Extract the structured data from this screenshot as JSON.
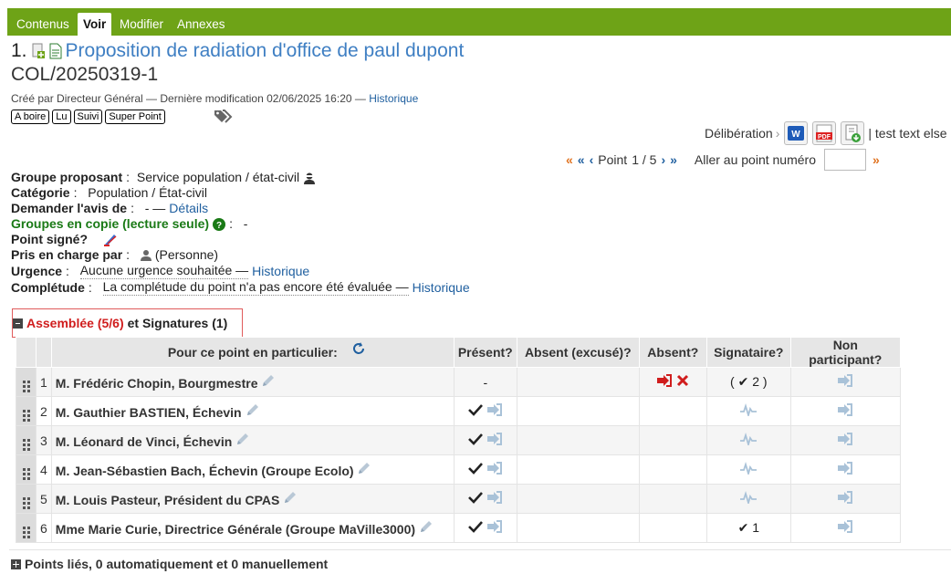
{
  "tabs": [
    {
      "label": "Contenus"
    },
    {
      "label": "Voir"
    },
    {
      "label": "Modifier"
    },
    {
      "label": "Annexes"
    }
  ],
  "item": {
    "number": "1.",
    "title": "Proposition de radiation d'office de paul dupont",
    "reference": "COL/20250319-1",
    "meta_prefix": "Créé par Directeur Général — Dernière modification 02/06/2025 16:20 —",
    "meta_link": "Historique",
    "labels": [
      "A boire",
      "Lu",
      "Suivi",
      "Super Point"
    ]
  },
  "actions": {
    "deliberation_label": "Délibération",
    "extra_text": "| test text else"
  },
  "navigation": {
    "point_label": "Point",
    "point_value": "1 / 5",
    "goto_label": "Aller au point numéro",
    "goto_value": ""
  },
  "fields": {
    "groupe_proposant": {
      "label": "Groupe proposant",
      "value": "Service population / état-civil"
    },
    "categorie": {
      "label": "Catégorie",
      "value": "Population / État-civil"
    },
    "avis": {
      "label": "Demander l'avis de",
      "value": "- —",
      "link": "Détails"
    },
    "groupes_copie": {
      "label": "Groupes en copie (lecture seule)",
      "value": "-"
    },
    "point_signe": {
      "label": "Point signé?"
    },
    "pris_en_charge": {
      "label": "Pris en charge par",
      "value": "(Personne)"
    },
    "urgence": {
      "label": "Urgence",
      "value": "Aucune urgence souhaitée —",
      "link": "Historique"
    },
    "completude": {
      "label": "Complétude",
      "value": "La complétude du point n'a pas encore été évaluée —",
      "link": "Historique"
    }
  },
  "assembly": {
    "title_red": "Assemblée (5/6)",
    "title_rest": "et Signatures (1)",
    "headers": {
      "point": "Pour ce point en particulier:",
      "present": "Présent?",
      "excused": "Absent (excusé)?",
      "absent": "Absent?",
      "signatory": "Signataire?",
      "non_participant": "Non participant?"
    },
    "rows": [
      {
        "num": "1",
        "name": "M. Frédéric Chopin, Bourgmestre",
        "present": "-",
        "absent": "out-x",
        "signatory": "( ✔ 2 )"
      },
      {
        "num": "2",
        "name": "M. Gauthier BASTIEN, Échevin",
        "present": "check",
        "absent": "",
        "signatory": "sig"
      },
      {
        "num": "3",
        "name": "M. Léonard de Vinci, Échevin",
        "present": "check",
        "absent": "",
        "signatory": "sig"
      },
      {
        "num": "4",
        "name": "M. Jean-Sébastien Bach, Échevin (Groupe Ecolo)",
        "present": "check",
        "absent": "",
        "signatory": "sig"
      },
      {
        "num": "5",
        "name": "M. Louis Pasteur, Président du CPAS",
        "present": "check",
        "absent": "",
        "signatory": "sig"
      },
      {
        "num": "6",
        "name": "Mme Marie Curie, Directrice Générale (Groupe MaVille3000)",
        "present": "check",
        "absent": "",
        "signatory": "✔ 1"
      }
    ]
  },
  "linked": {
    "text": "Points liés, 0 automatiquement et 0 manuellement"
  },
  "colors": {
    "tabbar": "#6ea317",
    "title_link": "#3f7fc3",
    "red": "#d01d1d",
    "green_label": "#1a7a16"
  }
}
